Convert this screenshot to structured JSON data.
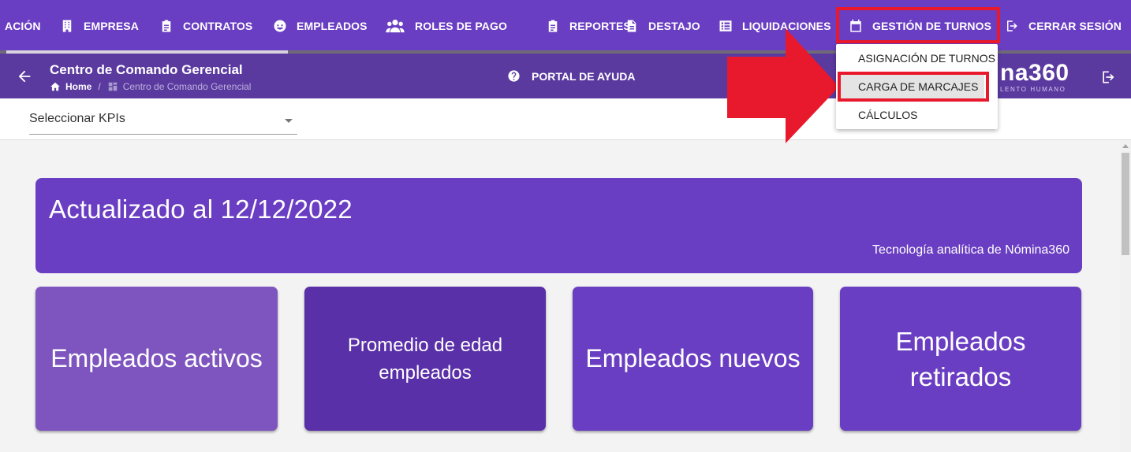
{
  "nav": {
    "items": [
      {
        "label": "ACIÓN",
        "icon": "none"
      },
      {
        "label": "EMPRESA",
        "icon": "building-icon"
      },
      {
        "label": "CONTRATOS",
        "icon": "clipboard-icon"
      },
      {
        "label": "EMPLEADOS",
        "icon": "face-icon"
      },
      {
        "label": "ROLES DE PAGO",
        "icon": "people-icon"
      },
      {
        "label": "REPORTES",
        "icon": "clipboard-icon"
      },
      {
        "label": "DESTAJO",
        "icon": "document-icon"
      },
      {
        "label": "LIQUIDACIONES",
        "icon": "list-icon"
      },
      {
        "label": "GESTIÓN DE TURNOS",
        "icon": "calendar-icon"
      },
      {
        "label": "CERRAR SESIÓN",
        "icon": "logout-icon"
      }
    ]
  },
  "header": {
    "title": "Centro de Comando Gerencial",
    "breadcrumb_home": "Home",
    "breadcrumb_sep": "/",
    "breadcrumb_current": "Centro de Comando Gerencial",
    "help_label": "PORTAL DE AYUDA",
    "logo_text": "na360",
    "logo_sub": "LENTO HUMANO"
  },
  "kpi": {
    "select_label": "Seleccionar KPIs"
  },
  "banner": {
    "title": "Actualizado al 12/12/2022",
    "subtitle": "Tecnología analítica de Nómina360"
  },
  "cards": [
    {
      "label": "Empleados activos",
      "color": "#7e55be"
    },
    {
      "label": "Promedio de edad empleados",
      "color": "#5a30a8"
    },
    {
      "label": "Empleados nuevos",
      "color": "#6a3ec2"
    },
    {
      "label": "Empleados retirados",
      "color": "#6a3ec2"
    }
  ],
  "dropdown": {
    "items": [
      {
        "label": "ASIGNACIÓN DE TURNOS"
      },
      {
        "label": "CARGA DE MARCAJES",
        "highlighted": true
      },
      {
        "label": "CÁLCULOS"
      }
    ]
  },
  "colors": {
    "primary": "#6a3ec2",
    "subheader": "#5b3aa0",
    "annotation": "#e8192c"
  }
}
